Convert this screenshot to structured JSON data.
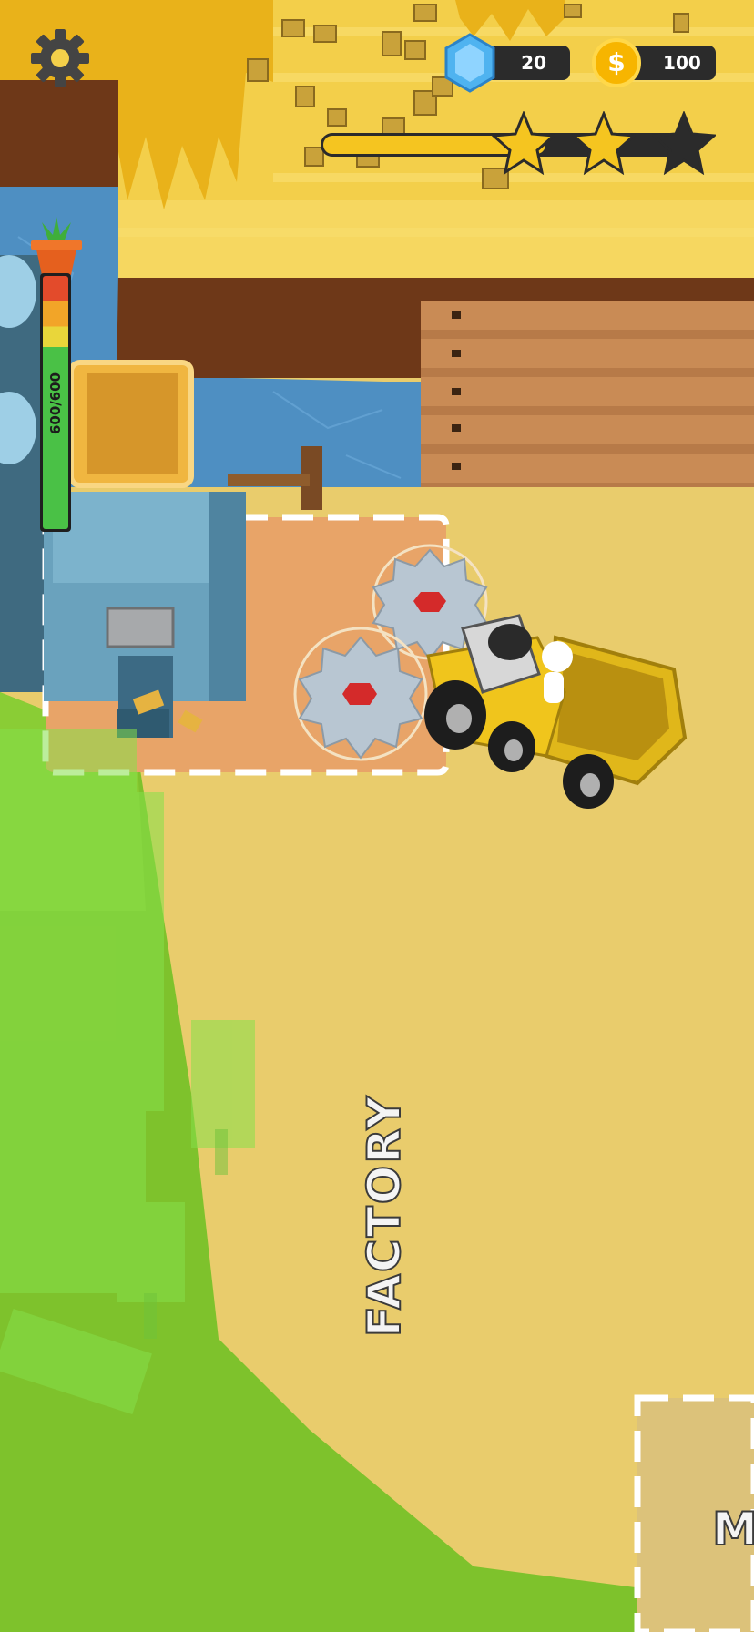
{
  "hud": {
    "settings_icon": "gear-icon",
    "gems": {
      "icon": "gem-icon",
      "value": "20"
    },
    "coins": {
      "icon": "coin-icon",
      "symbol": "$",
      "value": "100"
    },
    "level_progress": {
      "fraction": 0.62,
      "stars_earned": 2,
      "stars_total": 3
    }
  },
  "meter": {
    "label": "600/600",
    "fraction": 1.0,
    "icon": "plant-pot-icon"
  },
  "zones": {
    "factory": "FACTORY",
    "next": "M"
  },
  "colors": {
    "ground": "#e9cc6c",
    "grass": "#7ec22c",
    "wheat": "#f2c12c",
    "water": "#4e8fc2",
    "hud_dark": "#2b2b2b",
    "star": "#f5c520",
    "gem": "#4fb3f0",
    "coin": "#f7b500"
  }
}
